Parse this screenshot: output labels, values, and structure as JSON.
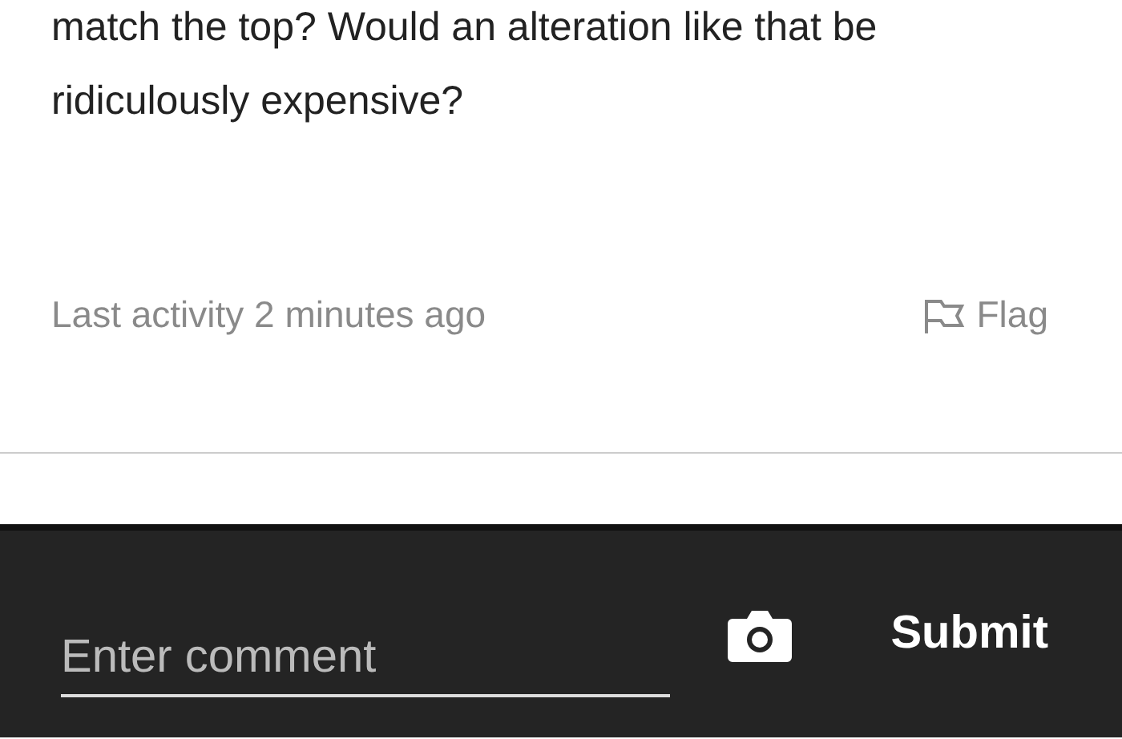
{
  "question": {
    "text": "match the top? Would an alteration like that be ridiculously expensive?"
  },
  "meta": {
    "activity": "Last activity 2 minutes ago",
    "flag": "Flag"
  },
  "comment_bar": {
    "placeholder": "Enter comment",
    "submit": "Submit"
  }
}
